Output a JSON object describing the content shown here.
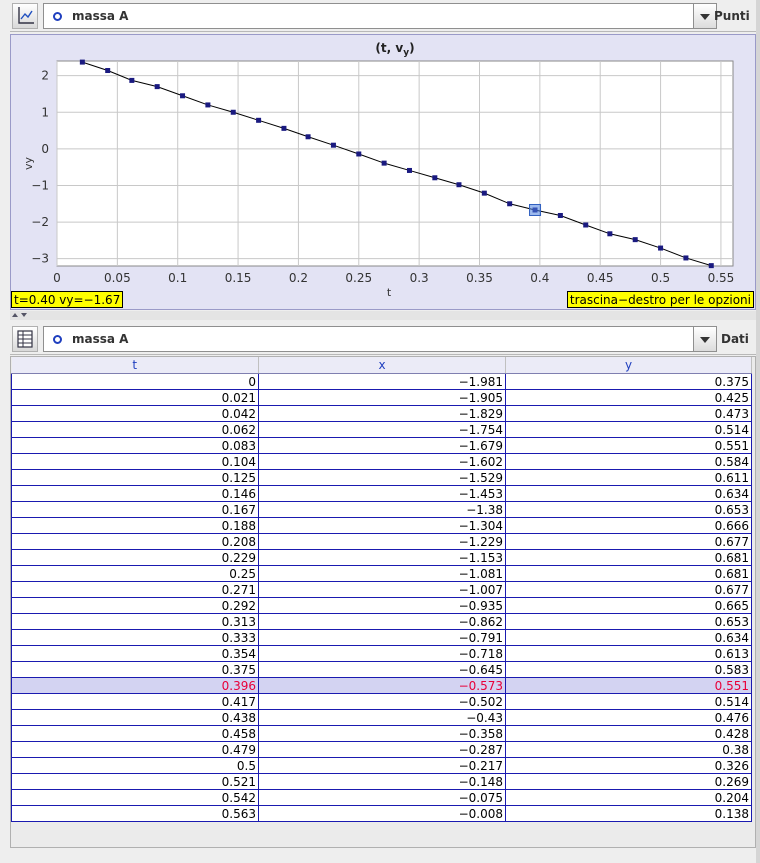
{
  "plot_toolbar": {
    "object": "massa A",
    "mode": "Punti"
  },
  "plot": {
    "status_left": "t=0.40  vy=-1.67",
    "status_right": "trascina-destro per le opzioni"
  },
  "chart_data": {
    "type": "line",
    "title": "(t, vy)",
    "xlabel": "t",
    "ylabel": "vy",
    "xlim": [
      0,
      0.56
    ],
    "ylim": [
      -3.2,
      2.4
    ],
    "xticks": [
      0,
      0.05,
      0.1,
      0.15,
      0.2,
      0.25,
      0.3,
      0.35,
      0.4,
      0.45,
      0.5,
      0.55
    ],
    "yticks": [
      2,
      1,
      0,
      -1,
      -2,
      -3
    ],
    "grid": true,
    "x": [
      0.021,
      0.042,
      0.062,
      0.083,
      0.104,
      0.125,
      0.146,
      0.167,
      0.188,
      0.208,
      0.229,
      0.25,
      0.271,
      0.292,
      0.313,
      0.333,
      0.354,
      0.375,
      0.396,
      0.417,
      0.438,
      0.458,
      0.479,
      0.5,
      0.521,
      0.542
    ],
    "y": [
      2.37,
      2.14,
      1.87,
      1.7,
      1.45,
      1.2,
      1.0,
      0.78,
      0.56,
      0.33,
      0.1,
      -0.14,
      -0.39,
      -0.59,
      -0.79,
      -0.98,
      -1.21,
      -1.5,
      -1.67,
      -1.82,
      -2.08,
      -2.32,
      -2.48,
      -2.71,
      -2.98,
      -3.19
    ],
    "highlight_index": 18,
    "color": "#1a1a80"
  },
  "table_toolbar": {
    "object": "massa A",
    "mode": "Dati"
  },
  "table": {
    "headers": [
      "t",
      "x",
      "y"
    ],
    "rows": [
      [
        "0",
        "-1.981",
        "0.375"
      ],
      [
        "0.021",
        "-1.905",
        "0.425"
      ],
      [
        "0.042",
        "-1.829",
        "0.473"
      ],
      [
        "0.062",
        "-1.754",
        "0.514"
      ],
      [
        "0.083",
        "-1.679",
        "0.551"
      ],
      [
        "0.104",
        "-1.602",
        "0.584"
      ],
      [
        "0.125",
        "-1.529",
        "0.611"
      ],
      [
        "0.146",
        "-1.453",
        "0.634"
      ],
      [
        "0.167",
        "-1.38",
        "0.653"
      ],
      [
        "0.188",
        "-1.304",
        "0.666"
      ],
      [
        "0.208",
        "-1.229",
        "0.677"
      ],
      [
        "0.229",
        "-1.153",
        "0.681"
      ],
      [
        "0.25",
        "-1.081",
        "0.681"
      ],
      [
        "0.271",
        "-1.007",
        "0.677"
      ],
      [
        "0.292",
        "-0.935",
        "0.665"
      ],
      [
        "0.313",
        "-0.862",
        "0.653"
      ],
      [
        "0.333",
        "-0.791",
        "0.634"
      ],
      [
        "0.354",
        "-0.718",
        "0.613"
      ],
      [
        "0.375",
        "-0.645",
        "0.583"
      ],
      [
        "0.396",
        "-0.573",
        "0.551"
      ],
      [
        "0.417",
        "-0.502",
        "0.514"
      ],
      [
        "0.438",
        "-0.43",
        "0.476"
      ],
      [
        "0.458",
        "-0.358",
        "0.428"
      ],
      [
        "0.479",
        "-0.287",
        "0.38"
      ],
      [
        "0.5",
        "-0.217",
        "0.326"
      ],
      [
        "0.521",
        "-0.148",
        "0.269"
      ],
      [
        "0.542",
        "-0.075",
        "0.204"
      ],
      [
        "0.563",
        "-0.008",
        "0.138"
      ]
    ],
    "selected_row": 19
  }
}
